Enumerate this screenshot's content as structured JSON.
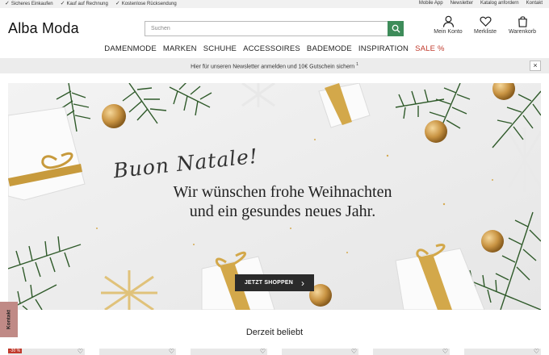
{
  "topbar": {
    "usps": [
      "Sicheres Einkaufen",
      "Kauf auf Rechnung",
      "Kostenlose Rücksendung"
    ],
    "links": [
      "Mobile App",
      "Newsletter",
      "Katalog anfordern",
      "Kontakt"
    ]
  },
  "header": {
    "logo": "Alba Moda",
    "search_placeholder": "Suchen",
    "account_label": "Mein Konto",
    "wishlist_label": "Merkliste",
    "cart_label": "Warenkorb"
  },
  "nav": {
    "items": [
      "DAMENMODE",
      "MARKEN",
      "SCHUHE",
      "ACCESSOIRES",
      "BADEMODE",
      "INSPIRATION"
    ],
    "sale": "SALE %"
  },
  "newsletter_bar": {
    "text": "Hier für unseren Newsletter anmelden und  10€ Gutschein sichern ",
    "footnote": "1",
    "close": "×"
  },
  "hero": {
    "script_text": "Buon Natale!",
    "line1": "Wir wünschen frohe Weihnachten",
    "line2": "und ein gesundes neues Jahr.",
    "cta": "JETZT SHOPPEN",
    "cta_arrow": "›"
  },
  "kontakt_tab": "Kontakt",
  "section": {
    "title": "Derzeit beliebt"
  },
  "products": [
    {
      "badge": "-30 %"
    },
    {
      "badge": ""
    },
    {
      "badge": ""
    },
    {
      "badge": ""
    },
    {
      "badge": ""
    },
    {
      "badge": ""
    }
  ],
  "colors": {
    "accent_green": "#3e8c5a",
    "sale_red": "#c0392b",
    "kontakt_tab": "#c08a86"
  },
  "icons": [
    "check-icon",
    "search-icon",
    "user-icon",
    "heart-icon",
    "bag-icon",
    "close-icon",
    "chevron-right-icon"
  ]
}
